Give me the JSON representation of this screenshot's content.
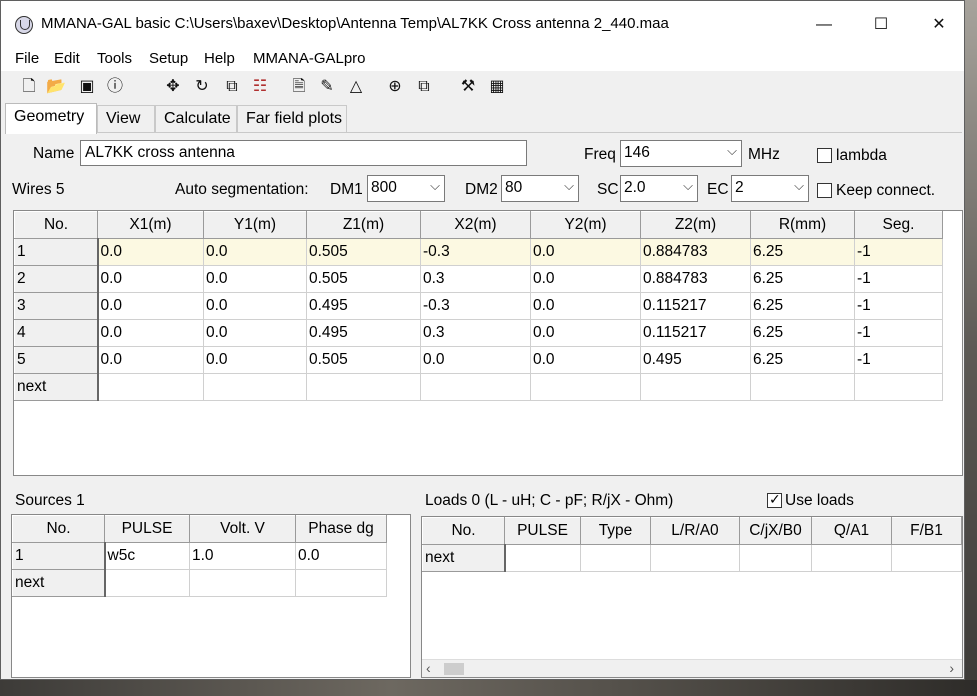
{
  "window": {
    "title": "MMANA-GAL basic C:\\Users\\baxev\\Desktop\\Antenna Temp\\AL7KK Cross antenna 2_440.maa",
    "minimize": "—",
    "maximize": "☐",
    "close": "✕"
  },
  "menu": [
    "File",
    "Edit",
    "Tools",
    "Setup",
    "Help",
    "MMANA-GALpro"
  ],
  "toolbar_icons": [
    "new-file-icon",
    "open-folder-icon",
    "save-icon",
    "info-icon",
    "move-icon",
    "rotate-icon",
    "copy-elements-icon",
    "ladder-icon",
    "document-icon",
    "eraser-icon",
    "triangle-icon",
    "target-icon",
    "duplicate-icon",
    "tools-icon",
    "calculator-icon"
  ],
  "tabs": [
    "Geometry",
    "View",
    "Calculate",
    "Far field plots"
  ],
  "geometry": {
    "name_label": "Name",
    "name_value": "AL7KK cross antenna",
    "freq_label": "Freq",
    "freq_value": "146",
    "freq_unit": "MHz",
    "lambda_label": "lambda",
    "wires_label": "Wires 5",
    "auto_seg_label": "Auto segmentation:",
    "dm1_label": "DM1",
    "dm1_value": "800",
    "dm2_label": "DM2",
    "dm2_value": "80",
    "sc_label": "SC",
    "sc_value": "2.0",
    "ec_label": "EC",
    "ec_value": "2",
    "keep_connect_label": "Keep connect."
  },
  "wires": {
    "columns": [
      "No.",
      "X1(m)",
      "Y1(m)",
      "Z1(m)",
      "X2(m)",
      "Y2(m)",
      "Z2(m)",
      "R(mm)",
      "Seg."
    ],
    "rows": [
      [
        "1",
        "0.0",
        "0.0",
        "0.505",
        "-0.3",
        "0.0",
        "0.884783",
        "6.25",
        "-1"
      ],
      [
        "2",
        "0.0",
        "0.0",
        "0.505",
        "0.3",
        "0.0",
        "0.884783",
        "6.25",
        "-1"
      ],
      [
        "3",
        "0.0",
        "0.0",
        "0.495",
        "-0.3",
        "0.0",
        "0.115217",
        "6.25",
        "-1"
      ],
      [
        "4",
        "0.0",
        "0.0",
        "0.495",
        "0.3",
        "0.0",
        "0.115217",
        "6.25",
        "-1"
      ],
      [
        "5",
        "0.0",
        "0.0",
        "0.505",
        "0.0",
        "0.0",
        "0.495",
        "6.25",
        "-1"
      ]
    ],
    "next_label": "next"
  },
  "sources": {
    "label": "Sources 1",
    "columns": [
      "No.",
      "PULSE",
      "Volt. V",
      "Phase dg"
    ],
    "rows": [
      [
        "1",
        "w5c",
        "1.0",
        "0.0"
      ]
    ],
    "next_label": "next"
  },
  "loads": {
    "label": "Loads 0 (L - uH; C - pF; R/jX - Ohm)",
    "use_loads_label": "Use loads",
    "columns": [
      "No.",
      "PULSE",
      "Type",
      "L/R/A0",
      "C/jX/B0",
      "Q/A1",
      "F/B1"
    ],
    "next_label": "next"
  }
}
